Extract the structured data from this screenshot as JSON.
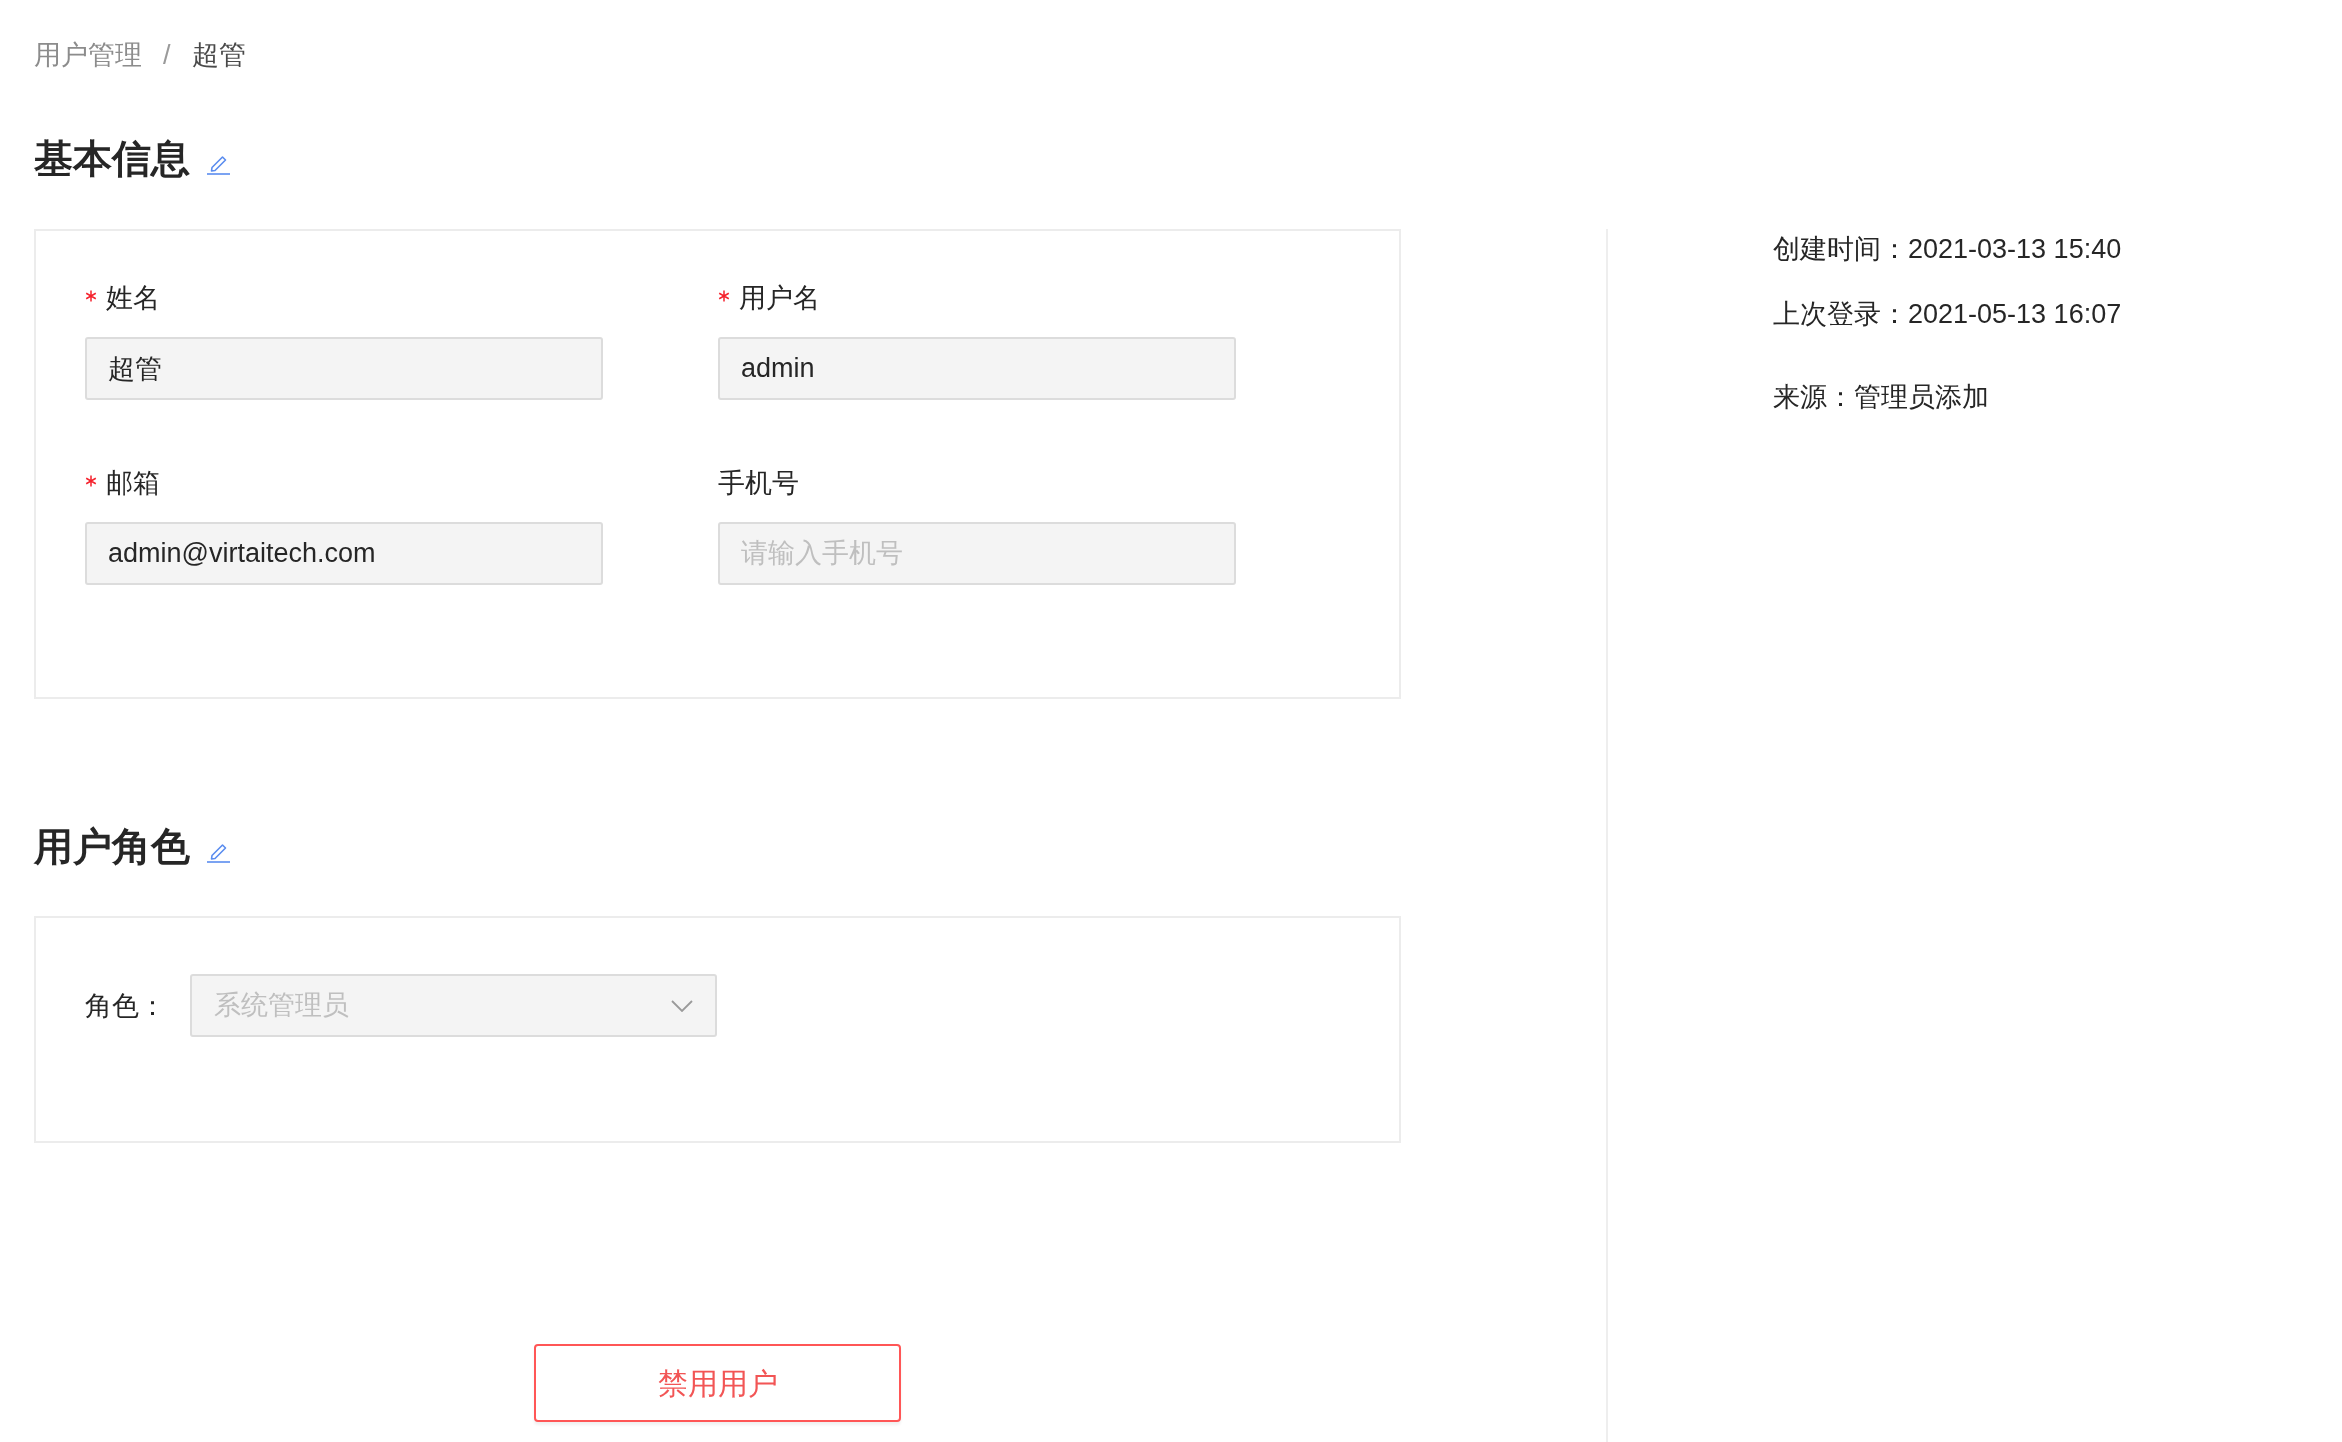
{
  "breadcrumb": {
    "separator": "/",
    "items": [
      {
        "label": "用户管理",
        "current": false
      },
      {
        "label": "超管",
        "current": true
      }
    ]
  },
  "sections": [
    {
      "kind": "form",
      "title": "基本信息",
      "fields": [
        {
          "label": "姓名",
          "required": true,
          "value": "超管"
        },
        {
          "label": "用户名",
          "required": true,
          "value": "admin"
        },
        {
          "label": "邮箱",
          "required": true,
          "value": "admin@virtaitech.com"
        },
        {
          "label": "手机号",
          "required": false,
          "placeholder": "请输入手机号"
        }
      ]
    },
    {
      "kind": "role",
      "title": "用户角色",
      "label": "角色：",
      "select": {
        "value": "系统管理员",
        "disabled": true
      }
    }
  ],
  "action_button": {
    "label": "禁用用户"
  },
  "info_panel": {
    "groups": [
      {
        "items": [
          {
            "label": "创建时间：",
            "value": "2021-03-13 15:40"
          },
          {
            "label": "上次登录：",
            "value": "2021-05-13 16:07"
          }
        ]
      },
      {
        "items": [
          {
            "label": "来源：",
            "value": "管理员添加"
          }
        ]
      }
    ]
  }
}
